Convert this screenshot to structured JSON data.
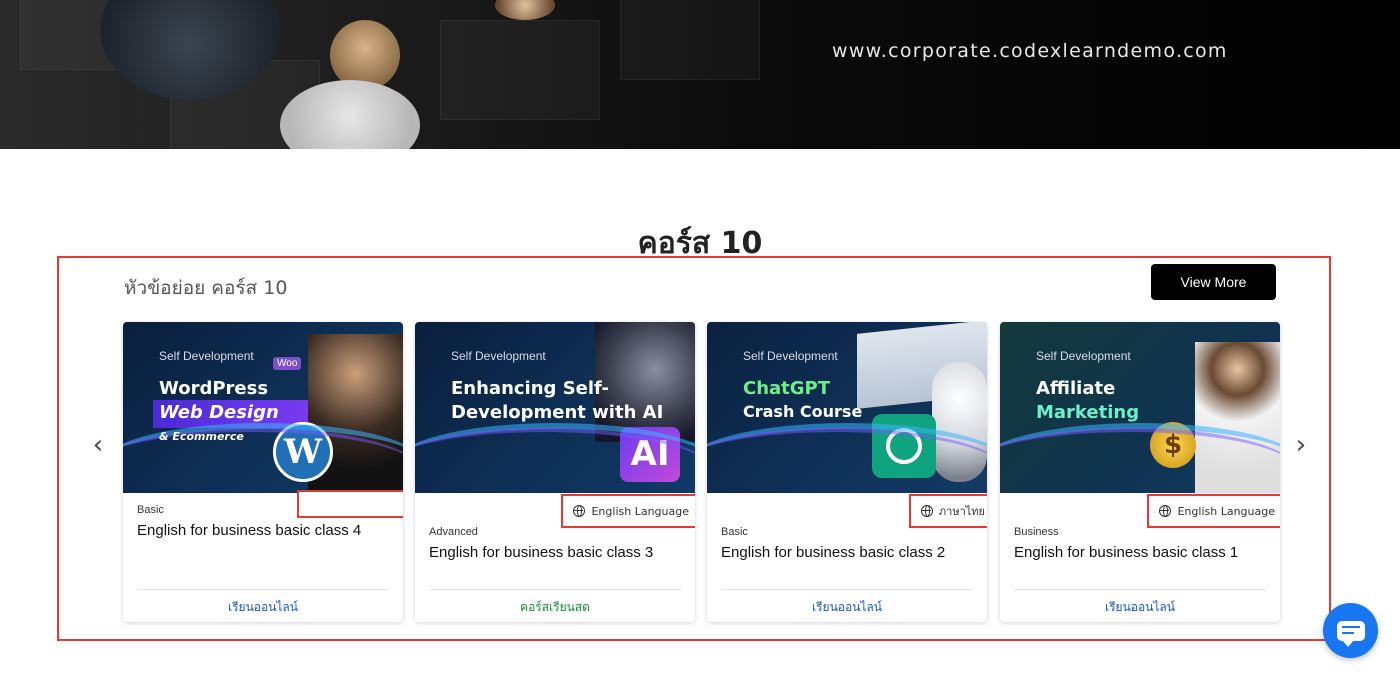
{
  "hero": {
    "url_text": "www.corporate.codexlearndemo.com"
  },
  "section": {
    "title": "คอร์ส 10",
    "subtitle": "หัวข้อย่อย คอร์ส 10",
    "view_more_label": "View More"
  },
  "nav": {
    "prev_icon": "chevron-left-icon",
    "next_icon": "chevron-right-icon"
  },
  "colors": {
    "online": "#1a56c9",
    "live": "#1a8f3a",
    "highlight_border": "#e53935",
    "chat": "#1976f2"
  },
  "cards": [
    {
      "thumb": {
        "category": "Self Development",
        "line1": "WordPress",
        "line2": "Web Design",
        "line3": "& Ecommerce",
        "corner_tag": "Woo"
      },
      "language": "",
      "level": "Basic",
      "title": "English for business basic class 4",
      "mode": "เรียนออนไลน์",
      "mode_kind": "online"
    },
    {
      "thumb": {
        "category": "Self Development",
        "line1": "Enhancing Self-",
        "line2": "Development with AI",
        "line3": "",
        "corner_tag": "AI"
      },
      "language": "English Language",
      "level": "Advanced",
      "title": "English for business basic class 3",
      "mode": "คอร์สเรียนสด",
      "mode_kind": "live"
    },
    {
      "thumb": {
        "category": "Self Development",
        "line1": "ChatGPT",
        "line2": "Crash Course",
        "line3": "",
        "corner_tag": ""
      },
      "language": "ภาษาไทย",
      "level": "Basic",
      "title": "English for business basic class 2",
      "mode": "เรียนออนไลน์",
      "mode_kind": "online"
    },
    {
      "thumb": {
        "category": "Self Development",
        "line1": "Affiliate",
        "line2": "Marketing",
        "line3": "",
        "corner_tag": ""
      },
      "language": "English Language",
      "level": "Business",
      "title": "English for business basic class 1",
      "mode": "เรียนออนไลน์",
      "mode_kind": "online"
    }
  ],
  "chat": {
    "icon": "chat-icon"
  }
}
